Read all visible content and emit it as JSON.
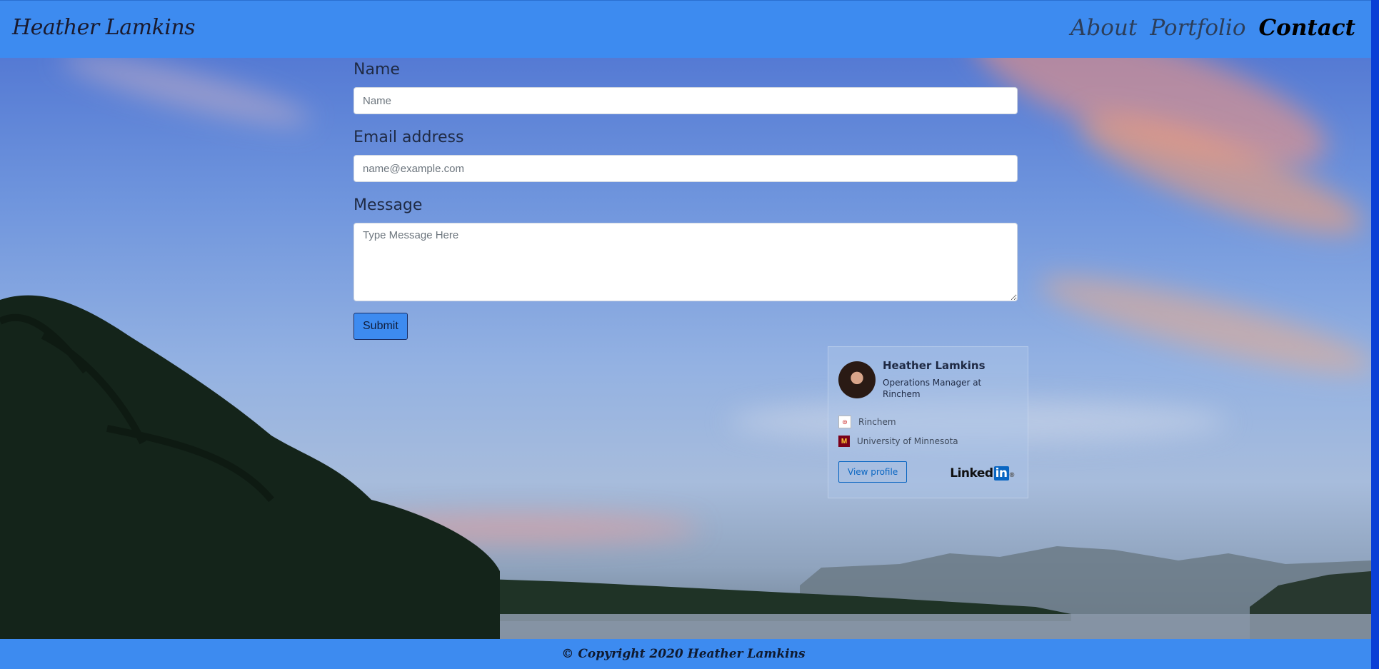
{
  "navbar": {
    "brand": "Heather Lamkins",
    "links": [
      {
        "label": "About"
      },
      {
        "label": "Portfolio"
      },
      {
        "label": "Contact"
      }
    ]
  },
  "form": {
    "name_label": "Name",
    "name_placeholder": "Name",
    "email_label": "Email address",
    "email_placeholder": "name@example.com",
    "message_label": "Message",
    "message_placeholder": "Type Message Here",
    "submit_label": "Submit"
  },
  "linkedin_card": {
    "name": "Heather Lamkins",
    "title": "Operations Manager at Rinchem",
    "company": "Rinchem",
    "education": "University of Minnesota",
    "view_profile_label": "View profile",
    "logo_text": "Linked",
    "logo_in": "in",
    "logo_mark": "®"
  },
  "footer": {
    "text": "© Copyright 2020 Heather Lamkins"
  },
  "colors": {
    "nav_bg": "#3d8bf0",
    "linkedin_blue": "#0a66c2"
  }
}
